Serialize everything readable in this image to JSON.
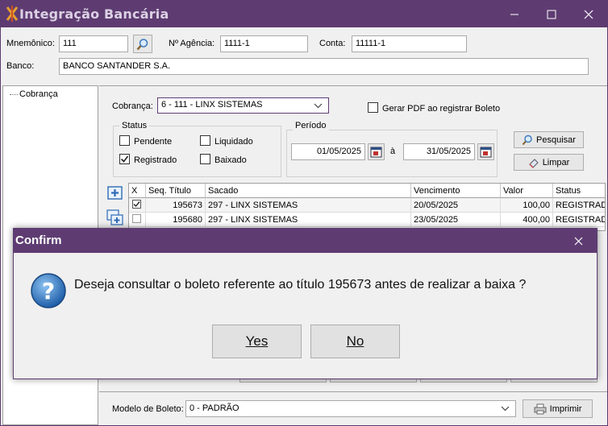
{
  "window": {
    "title": "Integração Bancária",
    "accent": "#5e3c72"
  },
  "header": {
    "mnemonico_label": "Mnemônico:",
    "mnemonico_value": "111",
    "agencia_label": "Nº Agência:",
    "agencia_value": "1111-1",
    "conta_label": "Conta:",
    "conta_value": "11111-1",
    "banco_label": "Banco:",
    "banco_value": "BANCO SANTANDER S.A."
  },
  "tree": {
    "items": [
      {
        "label": "Cobrança"
      }
    ]
  },
  "filters": {
    "cobranca_label": "Cobrança:",
    "cobranca_value": "6 - 111 - LINX SISTEMAS",
    "gerar_pdf_label": "Gerar PDF ao registrar Boleto",
    "status_title": "Status",
    "pendente": "Pendente",
    "liquidado": "Liquidado",
    "registrado": "Registrado",
    "baixado": "Baixado",
    "periodo_title": "Período",
    "date_from": "01/05/2025",
    "date_sep": "à",
    "date_to": "31/05/2025",
    "pesquisar": "Pesquisar",
    "limpar": "Limpar"
  },
  "grid": {
    "headers": [
      "X",
      "Seq. Título",
      "Sacado",
      "Vencimento",
      "Valor",
      "Status"
    ],
    "rows": [
      {
        "checked": true,
        "seq": "195673",
        "sacado": "297 - LINX SISTEMAS",
        "vencimento": "20/05/2025",
        "valor": "100,00",
        "status": "REGISTRADO"
      },
      {
        "checked": false,
        "seq": "195680",
        "sacado": "297 - LINX SISTEMAS",
        "vencimento": "23/05/2025",
        "valor": "400,00",
        "status": "REGISTRADO"
      }
    ]
  },
  "footer": {
    "modelo_label": "Modelo de Boleto:",
    "modelo_value": "0 - PADRÃO",
    "imprimir": "Imprimir"
  },
  "dialog": {
    "title": "Confirm",
    "message": "Deseja consultar o boleto referente ao título 195673 antes de realizar a baixa ?",
    "yes": "Yes",
    "no": "No"
  }
}
